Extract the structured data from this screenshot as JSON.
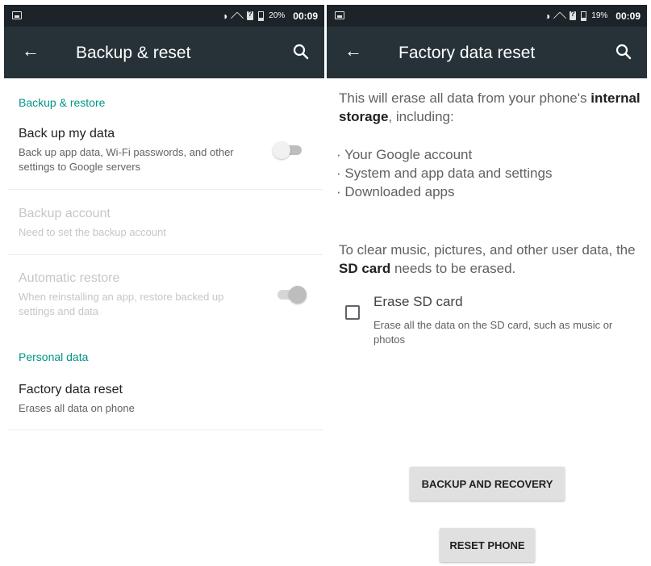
{
  "left": {
    "status": {
      "battery": "20%",
      "time": "00:09"
    },
    "appbar": {
      "title": "Backup & reset",
      "back_icon": "arrow-back-icon",
      "search_icon": "search-icon"
    },
    "sections": {
      "backup_restore": "Backup & restore",
      "personal_data": "Personal data"
    },
    "items": {
      "backup_my_data": {
        "title": "Back up my data",
        "subtitle": "Back up app data, Wi-Fi passwords, and other settings to Google servers",
        "toggle_on": false
      },
      "backup_account": {
        "title": "Backup account",
        "subtitle": "Need to set the backup account",
        "enabled": false
      },
      "automatic_restore": {
        "title": "Automatic restore",
        "subtitle": "When reinstalling an app, restore backed up settings and data",
        "toggle_on": true,
        "enabled": false
      },
      "factory_reset": {
        "title": "Factory data reset",
        "subtitle": "Erases all data on phone"
      }
    }
  },
  "right": {
    "status": {
      "battery": "19%",
      "time": "00:09"
    },
    "appbar": {
      "title": "Factory data reset",
      "back_icon": "arrow-back-icon",
      "search_icon": "search-icon"
    },
    "intro_pre": "This will erase all data from your phone's",
    "intro_bold": "internal storage",
    "intro_post": ", including:",
    "bullets": [
      "· Your Google account",
      "· System and app data and settings",
      "· Downloaded apps"
    ],
    "sd_pre": "To clear music, pictures, and other user data, the",
    "sd_bold": "SD card",
    "sd_post": " needs to be erased.",
    "erase_sd": {
      "title": "Erase SD card",
      "subtitle": "Erase all the data on the SD card, such as music or photos",
      "checked": false
    },
    "buttons": {
      "backup": "BACKUP AND RECOVERY",
      "reset": "RESET PHONE"
    }
  },
  "colors": {
    "status_bar": "#1c2329",
    "app_bar": "#263238",
    "accent": "#009688",
    "button_bg": "#e0e0e0"
  }
}
